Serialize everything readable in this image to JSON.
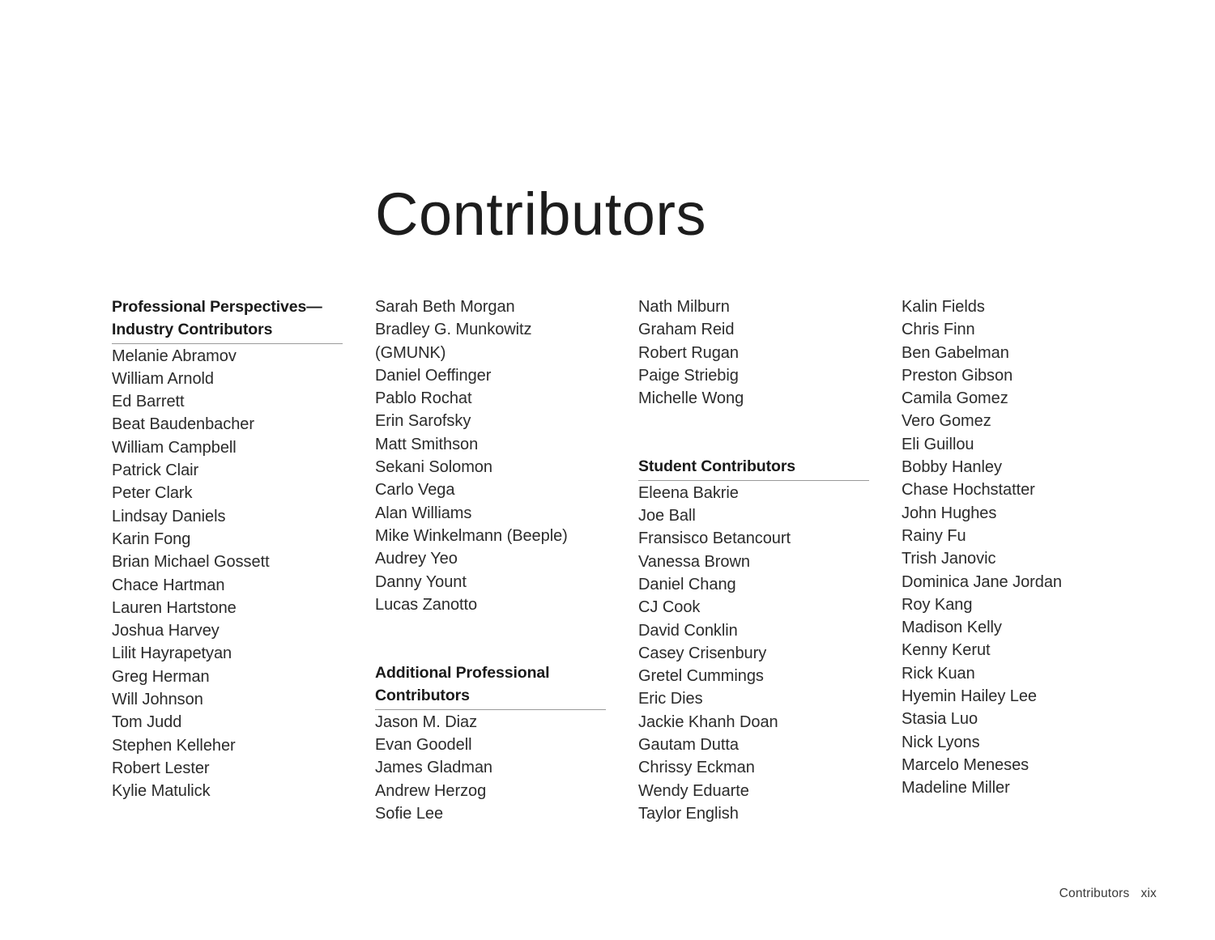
{
  "page": {
    "title": "Contributors",
    "footer": {
      "label": "Contributors",
      "folio": "xix"
    },
    "colors": {
      "text": "#2b2b2b",
      "heading": "#1a1a1a",
      "rule": "#9a9a9a",
      "background": "#ffffff"
    }
  },
  "columns": [
    {
      "sections": [
        {
          "heading": "Professional Perspectives—Industry Contributors",
          "heading_lines": [
            "Professional Perspectives—",
            "Industry Contributors"
          ],
          "has_rule": true,
          "names": [
            "Melanie Abramov",
            "William Arnold",
            "Ed Barrett",
            "Beat Baudenbacher",
            "William Campbell",
            "Patrick Clair",
            "Peter Clark",
            "Lindsay Daniels",
            "Karin Fong",
            "Brian Michael Gossett",
            "Chace Hartman",
            "Lauren Hartstone",
            "Joshua Harvey",
            "Lilit Hayrapetyan",
            "Greg Herman",
            "Will Johnson",
            "Tom Judd",
            "Stephen Kelleher",
            "Robert Lester",
            "Kylie Matulick"
          ]
        }
      ]
    },
    {
      "sections": [
        {
          "heading": "",
          "has_rule": false,
          "names": [
            "Sarah Beth Morgan",
            "Bradley G. Munkowitz",
            "(GMUNK)",
            "Daniel Oeffinger",
            "Pablo Rochat",
            "Erin Sarofsky",
            "Matt Smithson",
            "Sekani Solomon",
            "Carlo Vega",
            "Alan Williams",
            "Mike Winkelmann (Beeple)",
            "Audrey Yeo",
            "Danny Yount",
            "Lucas Zanotto"
          ]
        },
        {
          "heading": "Additional Professional Contributors",
          "heading_lines": [
            "Additional Professional",
            "Contributors"
          ],
          "has_rule": true,
          "names": [
            "Jason M. Diaz",
            "Evan Goodell",
            "James Gladman",
            "Andrew Herzog",
            "Sofie Lee"
          ]
        }
      ]
    },
    {
      "sections": [
        {
          "heading": "",
          "has_rule": false,
          "names": [
            "Nath Milburn",
            "Graham Reid",
            "Robert Rugan",
            "Paige Striebig",
            "Michelle Wong"
          ]
        },
        {
          "heading": "Student Contributors",
          "heading_lines": [
            "Student Contributors"
          ],
          "has_rule": true,
          "names": [
            "Eleena Bakrie",
            "Joe Ball",
            "Fransisco Betancourt",
            "Vanessa Brown",
            "Daniel Chang",
            "CJ Cook",
            "David Conklin",
            "Casey Crisenbury",
            "Gretel Cummings",
            "Eric Dies",
            "Jackie Khanh Doan",
            "Gautam Dutta",
            "Chrissy Eckman",
            "Wendy Eduarte",
            "Taylor English"
          ]
        }
      ]
    },
    {
      "sections": [
        {
          "heading": "",
          "has_rule": false,
          "names": [
            "Kalin Fields",
            "Chris Finn",
            "Ben Gabelman",
            "Preston Gibson",
            "Camila Gomez",
            "Vero Gomez",
            "Eli Guillou",
            "Bobby Hanley",
            "Chase Hochstatter",
            "John Hughes",
            "Rainy Fu",
            "Trish Janovic",
            "Dominica Jane Jordan",
            "Roy Kang",
            "Madison Kelly",
            "Kenny Kerut",
            "Rick Kuan",
            "Hyemin Hailey Lee",
            "Stasia Luo",
            "Nick Lyons",
            "Marcelo Meneses",
            "Madeline Miller"
          ]
        }
      ]
    }
  ]
}
